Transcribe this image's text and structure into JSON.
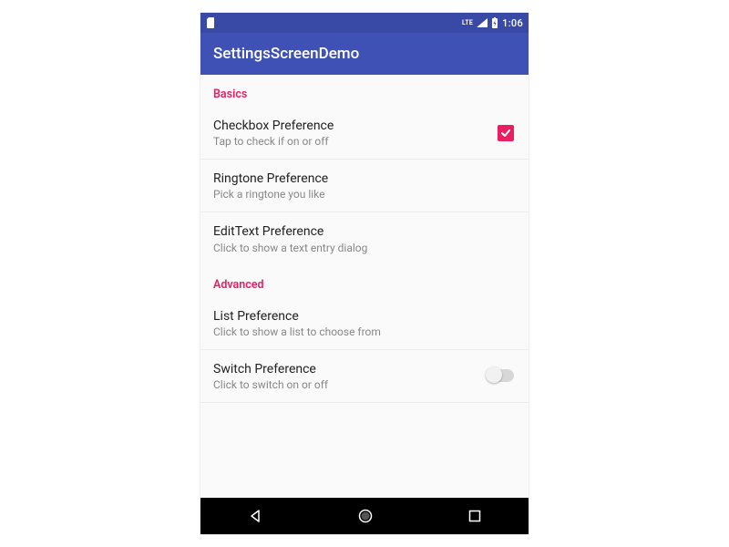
{
  "statusbar": {
    "clock": "1:06",
    "lte": "LTE"
  },
  "appbar": {
    "title": "SettingsScreenDemo"
  },
  "sections": {
    "basics": {
      "label": "Basics",
      "checkbox": {
        "title": "Checkbox Preference",
        "summary": "Tap to check if on or off"
      },
      "ringtone": {
        "title": "Ringtone Preference",
        "summary": "Pick a ringtone you like"
      },
      "edittext": {
        "title": "EditText Preference",
        "summary": "Click to show a text entry dialog"
      }
    },
    "advanced": {
      "label": "Advanced",
      "list": {
        "title": "List Preference",
        "summary": "Click to show a list to choose from"
      },
      "switch": {
        "title": "Switch Preference",
        "summary": "Click to switch on or off"
      }
    }
  }
}
